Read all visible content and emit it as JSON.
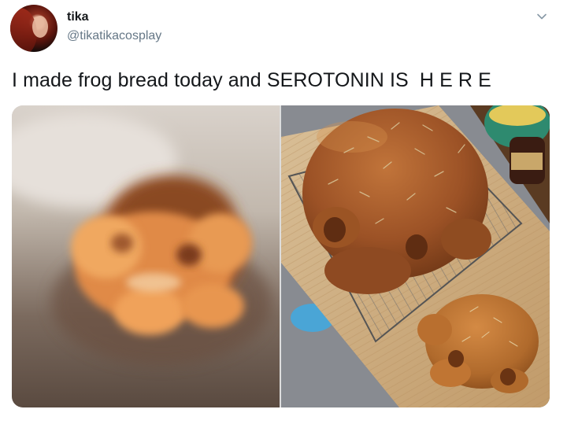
{
  "author": {
    "name": "tika",
    "handle": "@tikatikacosplay"
  },
  "tweet": {
    "text": "I made frog bread today and SEROTONIN IS  H E R E"
  },
  "icons": {
    "avatar": "profile-photo",
    "menu": "chevron-down-icon"
  },
  "media": {
    "count": 2,
    "photos": [
      {
        "description_name": "blurry-frog-bread"
      },
      {
        "description_name": "frog-breads-on-cutting-board"
      }
    ]
  },
  "colors": {
    "text": "#14171a",
    "secondary_text": "#657786",
    "background": "#ffffff"
  }
}
